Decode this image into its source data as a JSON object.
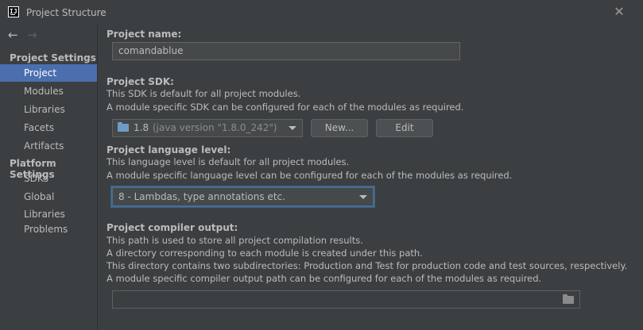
{
  "window": {
    "title": "Project Structure"
  },
  "sidebar": {
    "sections": [
      {
        "header": "Project Settings",
        "items": [
          "Project",
          "Modules",
          "Libraries",
          "Facets",
          "Artifacts"
        ]
      },
      {
        "header": "Platform Settings",
        "items": [
          "SDKs",
          "Global Libraries"
        ]
      }
    ],
    "extra_item": "Problems",
    "selected": "Project"
  },
  "main": {
    "project_name": {
      "label": "Project name:",
      "value": "comandablue"
    },
    "sdk": {
      "label": "Project SDK:",
      "desc1": "This SDK is default for all project modules.",
      "desc2": "A module specific SDK can be configured for each of the modules as required.",
      "selected_version": "1.8",
      "selected_detail": "(java version \"1.8.0_242\")",
      "new_button": "New...",
      "edit_button": "Edit"
    },
    "language_level": {
      "label": "Project language level:",
      "desc1": "This language level is default for all project modules.",
      "desc2": "A module specific language level can be configured for each of the modules as required.",
      "value": "8 - Lambdas, type annotations etc."
    },
    "compiler_output": {
      "label": "Project compiler output:",
      "desc1": "This path is used to store all project compilation results.",
      "desc2": "A directory corresponding to each module is created under this path.",
      "desc3": "This directory contains two subdirectories: Production and Test for production code and test sources, respectively.",
      "desc4": "A module specific compiler output path can be configured for each of the modules as required.",
      "value": ""
    }
  },
  "icons": [
    "app-logo-icon",
    "close-icon",
    "back-arrow-icon",
    "forward-arrow-icon",
    "folder-icon",
    "chevron-down-icon"
  ]
}
